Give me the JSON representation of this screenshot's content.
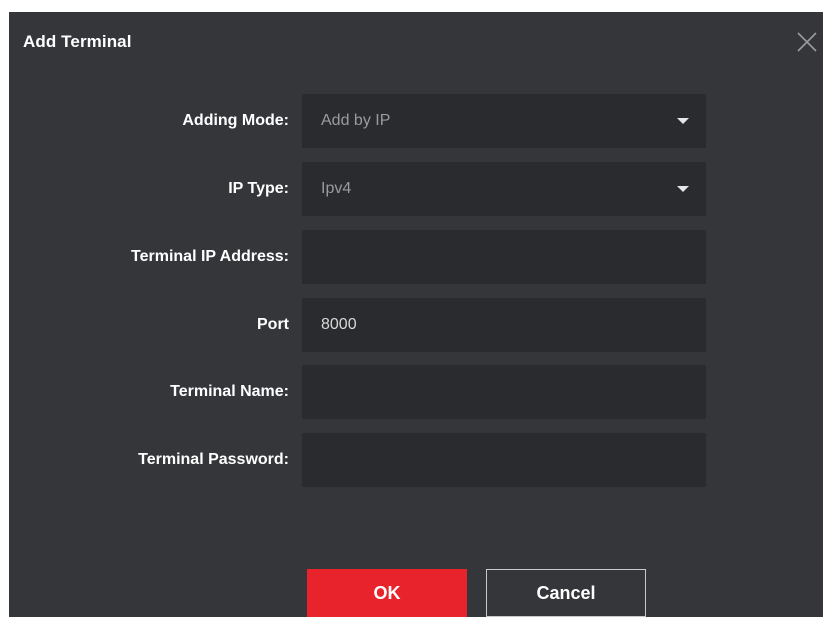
{
  "dialog": {
    "title": "Add Terminal",
    "close_icon": "close-icon"
  },
  "form": {
    "adding_mode": {
      "label": "Adding Mode:",
      "value": "Add by IP"
    },
    "ip_type": {
      "label": "IP Type:",
      "value": "Ipv4"
    },
    "terminal_ip": {
      "label": "Terminal IP Address:",
      "value": ""
    },
    "port": {
      "label": "Port",
      "value": "8000"
    },
    "terminal_name": {
      "label": "Terminal Name:",
      "value": ""
    },
    "terminal_password": {
      "label": "Terminal Password:",
      "value": ""
    }
  },
  "buttons": {
    "ok_label": "OK",
    "cancel_label": "Cancel"
  },
  "colors": {
    "background": "#35363a",
    "field": "#2a2b2e",
    "accent": "#e8232b"
  }
}
